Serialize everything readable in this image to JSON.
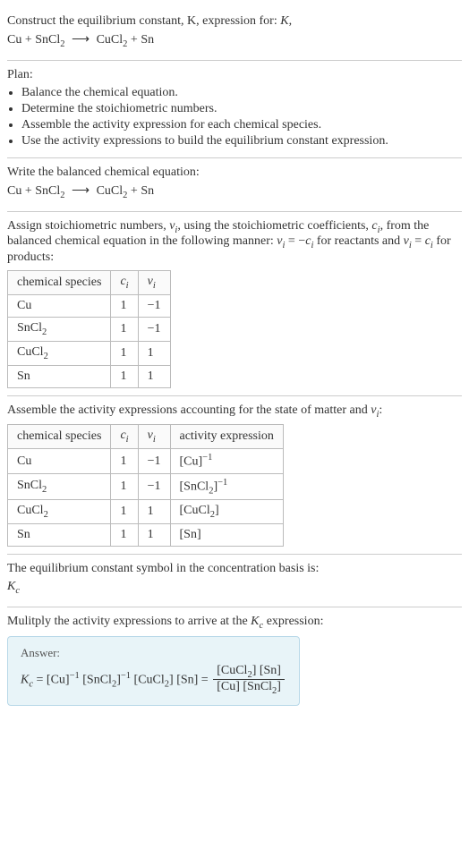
{
  "prompt": {
    "line1": "Construct the equilibrium constant, K, expression for:",
    "reaction_lhs1": "Cu",
    "reaction_lhs2": "SnCl",
    "reaction_lhs2_sub": "2",
    "arrow": "⟶",
    "reaction_rhs1": "CuCl",
    "reaction_rhs1_sub": "2",
    "reaction_rhs2": "Sn"
  },
  "plan": {
    "heading": "Plan:",
    "items": [
      "Balance the chemical equation.",
      "Determine the stoichiometric numbers.",
      "Assemble the activity expression for each chemical species.",
      "Use the activity expressions to build the equilibrium constant expression."
    ]
  },
  "balanced": {
    "heading": "Write the balanced chemical equation:"
  },
  "assign": {
    "text1": "Assign stoichiometric numbers, ",
    "nu": "ν",
    "sub_i": "i",
    "text2": ", using the stoichiometric coefficients, ",
    "c": "c",
    "text3": ", from the balanced chemical equation in the following manner: ",
    "eq1": " = −",
    "text4": " for reactants and ",
    "eq2": " = ",
    "text5": " for products:",
    "table": {
      "headers": {
        "species": "chemical species",
        "ci": "c",
        "ci_sub": "i",
        "nui": "ν",
        "nui_sub": "i"
      },
      "rows": [
        {
          "species": "Cu",
          "sub": "",
          "ci": "1",
          "nui": "−1"
        },
        {
          "species": "SnCl",
          "sub": "2",
          "ci": "1",
          "nui": "−1"
        },
        {
          "species": "CuCl",
          "sub": "2",
          "ci": "1",
          "nui": "1"
        },
        {
          "species": "Sn",
          "sub": "",
          "ci": "1",
          "nui": "1"
        }
      ]
    }
  },
  "activity": {
    "text1": "Assemble the activity expressions accounting for the state of matter and ",
    "text2": ":",
    "table": {
      "headers": {
        "species": "chemical species",
        "ci": "c",
        "ci_sub": "i",
        "nui": "ν",
        "nui_sub": "i",
        "act": "activity expression"
      },
      "rows": [
        {
          "species": "Cu",
          "sub": "",
          "ci": "1",
          "nui": "−1",
          "act_base": "[Cu]",
          "act_sup": "−1"
        },
        {
          "species": "SnCl",
          "sub": "2",
          "ci": "1",
          "nui": "−1",
          "act_base": "[SnCl",
          "act_sub": "2",
          "act_close": "]",
          "act_sup": "−1"
        },
        {
          "species": "CuCl",
          "sub": "2",
          "ci": "1",
          "nui": "1",
          "act_base": "[CuCl",
          "act_sub": "2",
          "act_close": "]",
          "act_sup": ""
        },
        {
          "species": "Sn",
          "sub": "",
          "ci": "1",
          "nui": "1",
          "act_base": "[Sn]",
          "act_sup": ""
        }
      ]
    }
  },
  "symbol": {
    "line1": "The equilibrium constant symbol in the concentration basis is:",
    "K": "K",
    "K_sub": "c"
  },
  "multiply": {
    "text1": "Mulitply the activity expressions to arrive at the ",
    "text2": " expression:"
  },
  "answer": {
    "label": "Answer:",
    "K": "K",
    "K_sub": "c",
    "eq": " = ",
    "t1": "[Cu]",
    "t1_sup": "−1",
    "t2a": " [SnCl",
    "t2_sub": "2",
    "t2b": "]",
    "t2_sup": "−1",
    "t3a": " [CuCl",
    "t3_sub": "2",
    "t3b": "] [Sn] = ",
    "frac_num_a": "[CuCl",
    "frac_num_sub": "2",
    "frac_num_b": "] [Sn]",
    "frac_den_a": "[Cu] [SnCl",
    "frac_den_sub": "2",
    "frac_den_b": "]"
  }
}
